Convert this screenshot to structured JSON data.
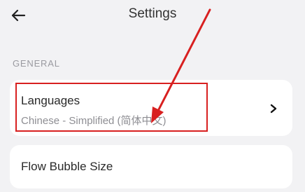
{
  "header": {
    "title": "Settings",
    "back_icon": "arrow-left-icon"
  },
  "general": {
    "section_label": "GENERAL",
    "items": [
      {
        "title": "Languages",
        "subtitle": "Chinese - Simplified (简体中文)",
        "trailing_icon": "chevron-right-icon"
      },
      {
        "title": "Flow Bubble Size"
      }
    ]
  },
  "annotation": {
    "color": "#d82020",
    "arrow_icon": "red-arrow-icon"
  }
}
